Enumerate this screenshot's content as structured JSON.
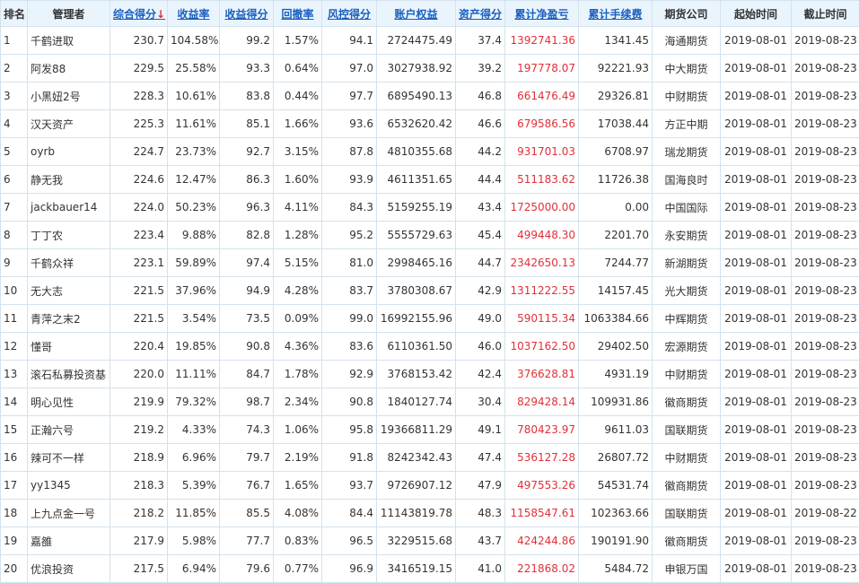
{
  "colors": {
    "header_bg": "#eaf4fc",
    "border": "#d3e2ee",
    "link": "#1a5fbf",
    "profit_red": "#e0303a"
  },
  "headers": {
    "rank": "排名",
    "manager": "管理者",
    "score": "综合得分",
    "sort_arrow": "↓",
    "return_rate": "收益率",
    "return_score": "收益得分",
    "drawdown": "回撤率",
    "risk_score": "风控得分",
    "equity": "账户权益",
    "asset_score": "资产得分",
    "net_profit": "累计净盈亏",
    "fees": "累计手续费",
    "company": "期货公司",
    "start": "起始时间",
    "end": "截止时间"
  },
  "rows": [
    {
      "rank": "1",
      "manager": "千鹤进取",
      "score": "230.7",
      "return_rate": "104.58%",
      "return_score": "99.2",
      "drawdown": "1.57%",
      "risk_score": "94.1",
      "equity": "2724475.49",
      "asset_score": "37.4",
      "net_profit": "1392741.36",
      "fees": "1341.45",
      "company": "海通期货",
      "start": "2019-08-01",
      "end": "2019-08-23"
    },
    {
      "rank": "2",
      "manager": "阿发88",
      "score": "229.5",
      "return_rate": "25.58%",
      "return_score": "93.3",
      "drawdown": "0.64%",
      "risk_score": "97.0",
      "equity": "3027938.92",
      "asset_score": "39.2",
      "net_profit": "197778.07",
      "fees": "92221.93",
      "company": "中大期货",
      "start": "2019-08-01",
      "end": "2019-08-23"
    },
    {
      "rank": "3",
      "manager": "小黑妞2号",
      "score": "228.3",
      "return_rate": "10.61%",
      "return_score": "83.8",
      "drawdown": "0.44%",
      "risk_score": "97.7",
      "equity": "6895490.13",
      "asset_score": "46.8",
      "net_profit": "661476.49",
      "fees": "29326.81",
      "company": "中财期货",
      "start": "2019-08-01",
      "end": "2019-08-23"
    },
    {
      "rank": "4",
      "manager": "汉天资产",
      "score": "225.3",
      "return_rate": "11.61%",
      "return_score": "85.1",
      "drawdown": "1.66%",
      "risk_score": "93.6",
      "equity": "6532620.42",
      "asset_score": "46.6",
      "net_profit": "679586.56",
      "fees": "17038.44",
      "company": "方正中期",
      "start": "2019-08-01",
      "end": "2019-08-23"
    },
    {
      "rank": "5",
      "manager": "oyrb",
      "score": "224.7",
      "return_rate": "23.73%",
      "return_score": "92.7",
      "drawdown": "3.15%",
      "risk_score": "87.8",
      "equity": "4810355.68",
      "asset_score": "44.2",
      "net_profit": "931701.03",
      "fees": "6708.97",
      "company": "瑞龙期货",
      "start": "2019-08-01",
      "end": "2019-08-23"
    },
    {
      "rank": "6",
      "manager": "静无我",
      "score": "224.6",
      "return_rate": "12.47%",
      "return_score": "86.3",
      "drawdown": "1.60%",
      "risk_score": "93.9",
      "equity": "4611351.65",
      "asset_score": "44.4",
      "net_profit": "511183.62",
      "fees": "11726.38",
      "company": "国海良时",
      "start": "2019-08-01",
      "end": "2019-08-23"
    },
    {
      "rank": "7",
      "manager": "jackbauer14",
      "score": "224.0",
      "return_rate": "50.23%",
      "return_score": "96.3",
      "drawdown": "4.11%",
      "risk_score": "84.3",
      "equity": "5159255.19",
      "asset_score": "43.4",
      "net_profit": "1725000.00",
      "fees": "0.00",
      "company": "中国国际",
      "start": "2019-08-01",
      "end": "2019-08-23"
    },
    {
      "rank": "8",
      "manager": "丁丁农",
      "score": "223.4",
      "return_rate": "9.88%",
      "return_score": "82.8",
      "drawdown": "1.28%",
      "risk_score": "95.2",
      "equity": "5555729.63",
      "asset_score": "45.4",
      "net_profit": "499448.30",
      "fees": "2201.70",
      "company": "永安期货",
      "start": "2019-08-01",
      "end": "2019-08-23"
    },
    {
      "rank": "9",
      "manager": "千鹤众祥",
      "score": "223.1",
      "return_rate": "59.89%",
      "return_score": "97.4",
      "drawdown": "5.15%",
      "risk_score": "81.0",
      "equity": "2998465.16",
      "asset_score": "44.7",
      "net_profit": "2342650.13",
      "fees": "7244.77",
      "company": "新湖期货",
      "start": "2019-08-01",
      "end": "2019-08-23"
    },
    {
      "rank": "10",
      "manager": "无大志",
      "score": "221.5",
      "return_rate": "37.96%",
      "return_score": "94.9",
      "drawdown": "4.28%",
      "risk_score": "83.7",
      "equity": "3780308.67",
      "asset_score": "42.9",
      "net_profit": "1311222.55",
      "fees": "14157.45",
      "company": "光大期货",
      "start": "2019-08-01",
      "end": "2019-08-23"
    },
    {
      "rank": "11",
      "manager": "青萍之末2",
      "score": "221.5",
      "return_rate": "3.54%",
      "return_score": "73.5",
      "drawdown": "0.09%",
      "risk_score": "99.0",
      "equity": "16992155.96",
      "asset_score": "49.0",
      "net_profit": "590115.34",
      "fees": "1063384.66",
      "company": "中辉期货",
      "start": "2019-08-01",
      "end": "2019-08-23"
    },
    {
      "rank": "12",
      "manager": "懂哥",
      "score": "220.4",
      "return_rate": "19.85%",
      "return_score": "90.8",
      "drawdown": "4.36%",
      "risk_score": "83.6",
      "equity": "6110361.50",
      "asset_score": "46.0",
      "net_profit": "1037162.50",
      "fees": "29402.50",
      "company": "宏源期货",
      "start": "2019-08-01",
      "end": "2019-08-23"
    },
    {
      "rank": "13",
      "manager": "滚石私募投资基",
      "score": "220.0",
      "return_rate": "11.11%",
      "return_score": "84.7",
      "drawdown": "1.78%",
      "risk_score": "92.9",
      "equity": "3768153.42",
      "asset_score": "42.4",
      "net_profit": "376628.81",
      "fees": "4931.19",
      "company": "中财期货",
      "start": "2019-08-01",
      "end": "2019-08-23"
    },
    {
      "rank": "14",
      "manager": "明心见性",
      "score": "219.9",
      "return_rate": "79.32%",
      "return_score": "98.7",
      "drawdown": "2.34%",
      "risk_score": "90.8",
      "equity": "1840127.74",
      "asset_score": "30.4",
      "net_profit": "829428.14",
      "fees": "109931.86",
      "company": "徽商期货",
      "start": "2019-08-01",
      "end": "2019-08-23"
    },
    {
      "rank": "15",
      "manager": "正瀚六号",
      "score": "219.2",
      "return_rate": "4.33%",
      "return_score": "74.3",
      "drawdown": "1.06%",
      "risk_score": "95.8",
      "equity": "19366811.29",
      "asset_score": "49.1",
      "net_profit": "780423.97",
      "fees": "9611.03",
      "company": "国联期货",
      "start": "2019-08-01",
      "end": "2019-08-23"
    },
    {
      "rank": "16",
      "manager": "辣可不一样",
      "score": "218.9",
      "return_rate": "6.96%",
      "return_score": "79.7",
      "drawdown": "2.19%",
      "risk_score": "91.8",
      "equity": "8242342.43",
      "asset_score": "47.4",
      "net_profit": "536127.28",
      "fees": "26807.72",
      "company": "中财期货",
      "start": "2019-08-01",
      "end": "2019-08-23"
    },
    {
      "rank": "17",
      "manager": "yy1345",
      "score": "218.3",
      "return_rate": "5.39%",
      "return_score": "76.7",
      "drawdown": "1.65%",
      "risk_score": "93.7",
      "equity": "9726907.12",
      "asset_score": "47.9",
      "net_profit": "497553.26",
      "fees": "54531.74",
      "company": "徽商期货",
      "start": "2019-08-01",
      "end": "2019-08-23"
    },
    {
      "rank": "18",
      "manager": "上九点金一号",
      "score": "218.2",
      "return_rate": "11.85%",
      "return_score": "85.5",
      "drawdown": "4.08%",
      "risk_score": "84.4",
      "equity": "11143819.78",
      "asset_score": "48.3",
      "net_profit": "1158547.61",
      "fees": "102363.66",
      "company": "国联期货",
      "start": "2019-08-01",
      "end": "2019-08-22"
    },
    {
      "rank": "19",
      "manager": "嘉雒",
      "score": "217.9",
      "return_rate": "5.98%",
      "return_score": "77.7",
      "drawdown": "0.83%",
      "risk_score": "96.5",
      "equity": "3229515.68",
      "asset_score": "43.7",
      "net_profit": "424244.86",
      "fees": "190191.90",
      "company": "徽商期货",
      "start": "2019-08-01",
      "end": "2019-08-23"
    },
    {
      "rank": "20",
      "manager": "优浪投资",
      "score": "217.5",
      "return_rate": "6.94%",
      "return_score": "79.6",
      "drawdown": "0.77%",
      "risk_score": "96.9",
      "equity": "3416519.15",
      "asset_score": "41.0",
      "net_profit": "221868.02",
      "fees": "5484.72",
      "company": "申银万国",
      "start": "2019-08-01",
      "end": "2019-08-23"
    }
  ]
}
